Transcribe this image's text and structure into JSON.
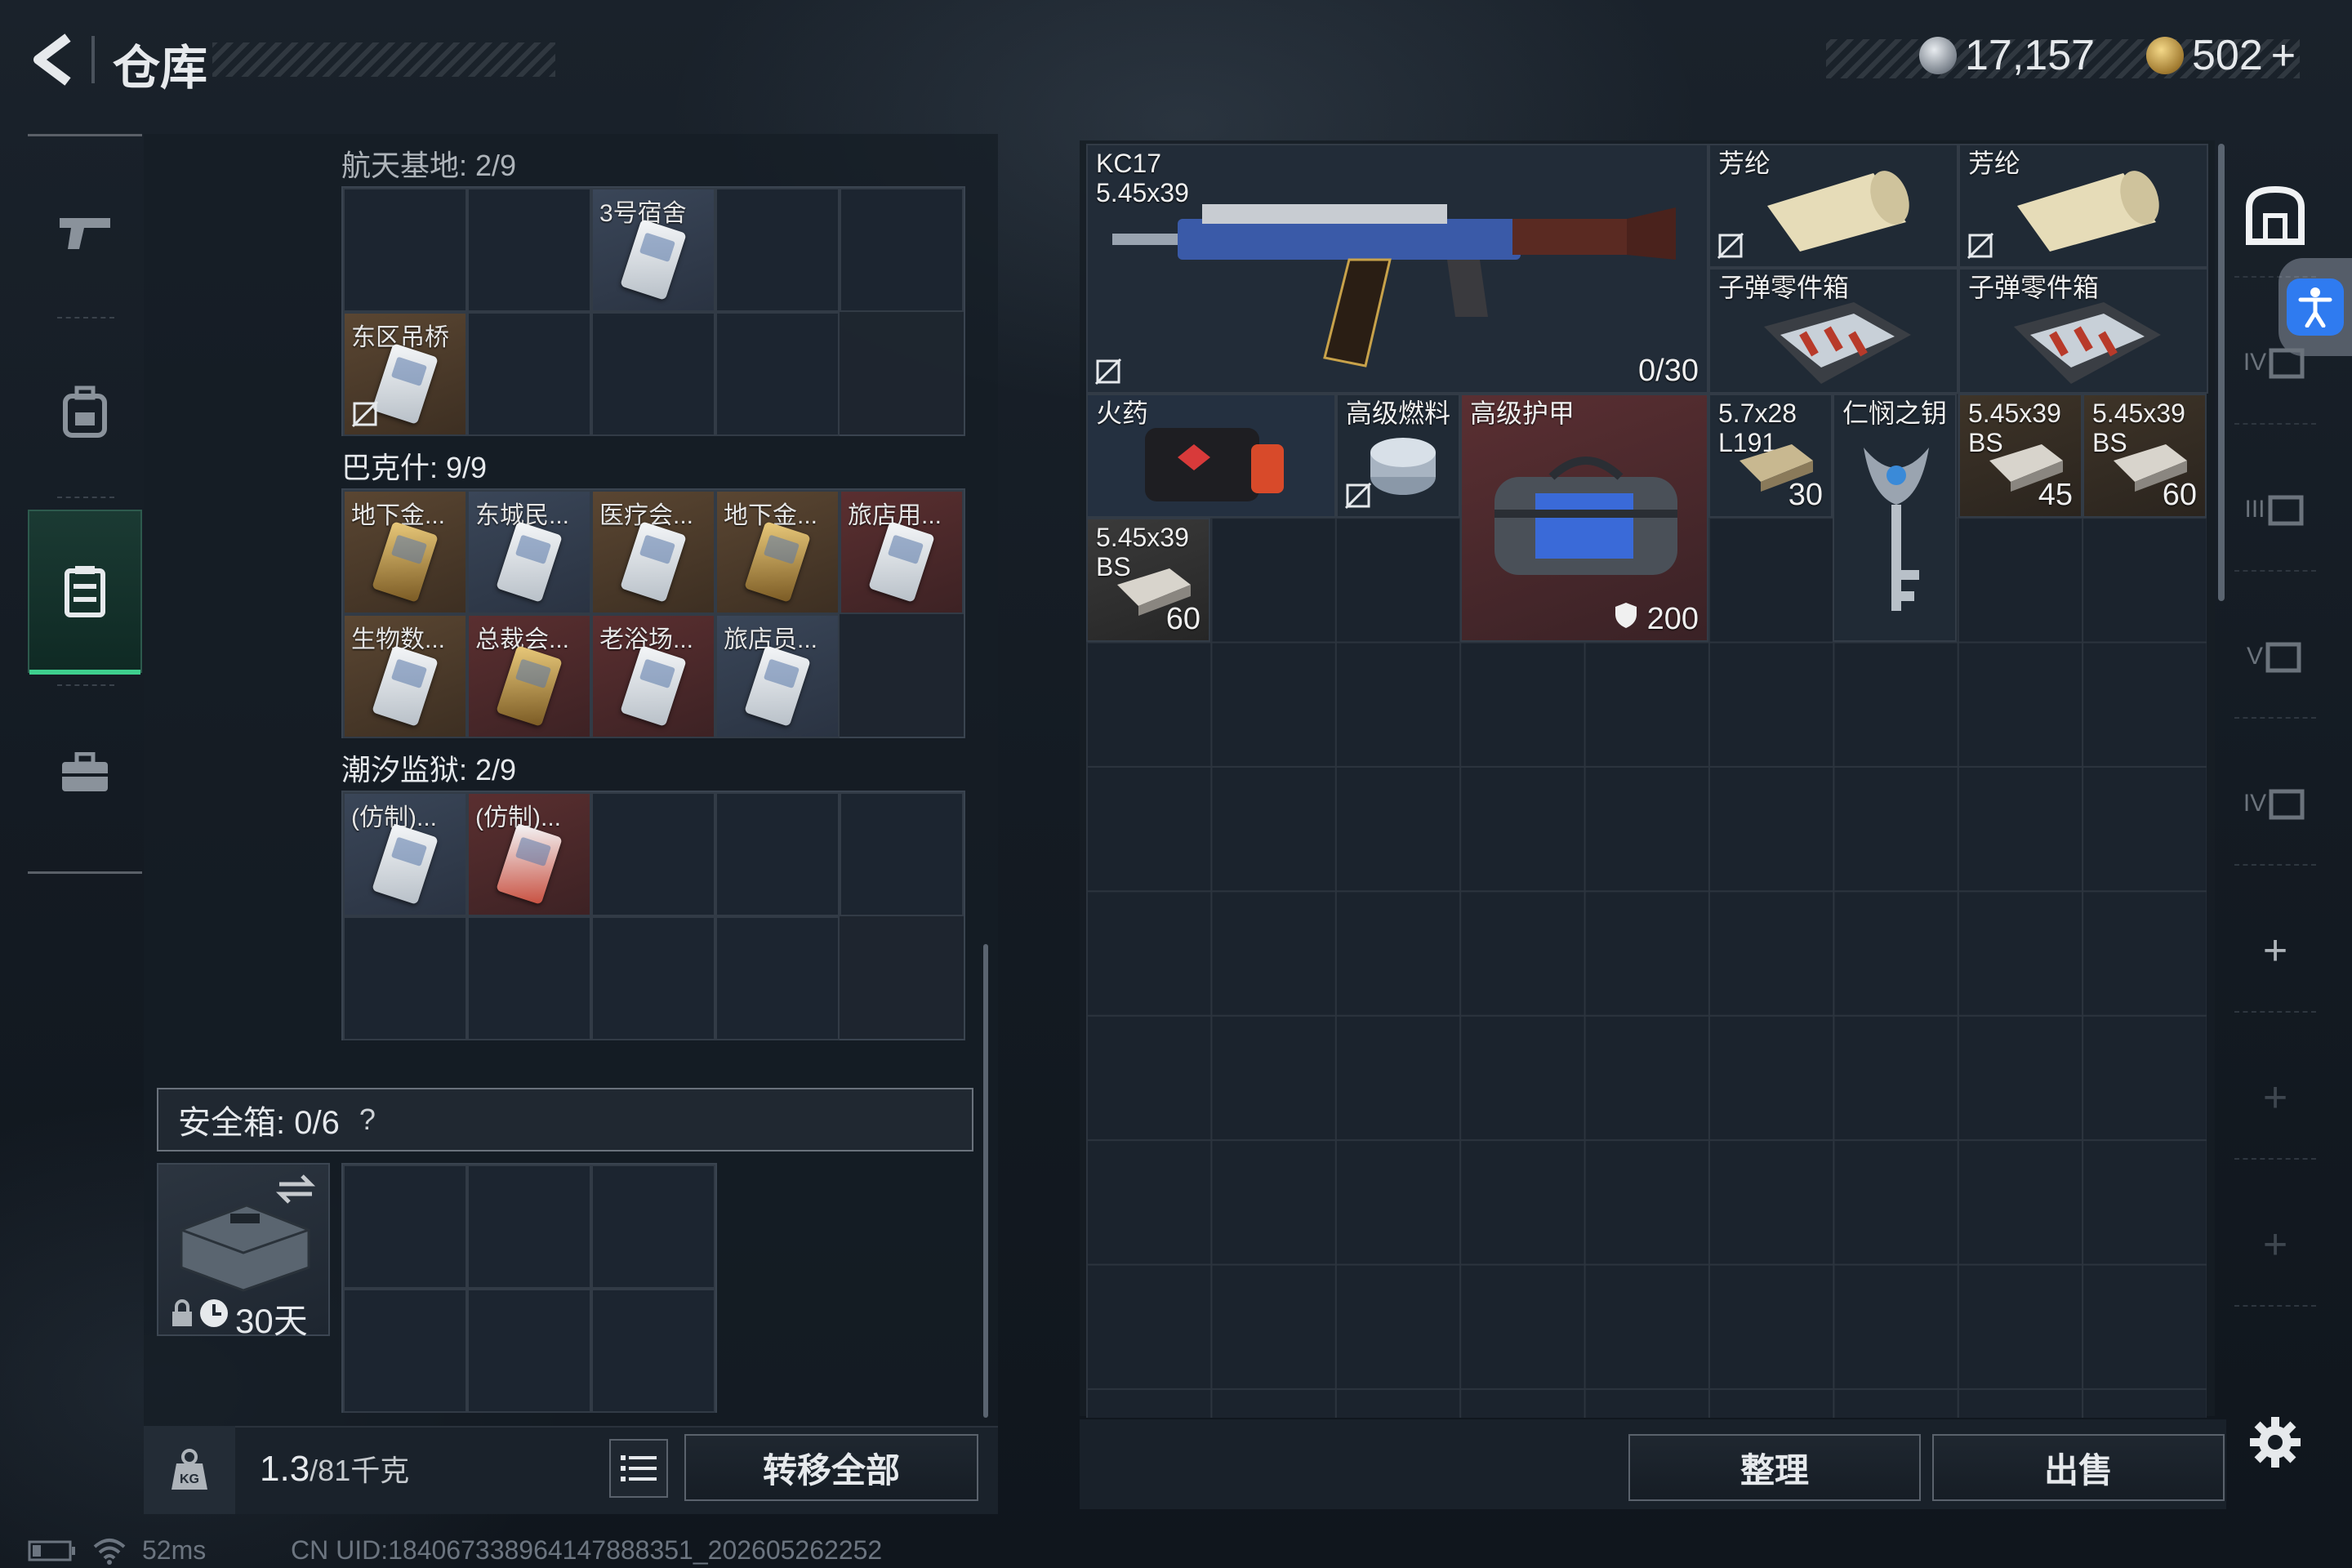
{
  "header": {
    "title": "仓库",
    "currency_silver": "17,157",
    "currency_gold": "502",
    "gold_plus": "+"
  },
  "warehouse": {
    "sections": [
      {
        "title": "航天基地: 2/9",
        "items": [
          {
            "label": "3号宿舍"
          },
          {
            "label": "东区吊桥"
          }
        ]
      },
      {
        "title": "巴克什: 9/9",
        "items": [
          {
            "label": "地下金..."
          },
          {
            "label": "东城民..."
          },
          {
            "label": "医疗会..."
          },
          {
            "label": "地下金..."
          },
          {
            "label": "旅店用..."
          },
          {
            "label": "生物数..."
          },
          {
            "label": "总裁会..."
          },
          {
            "label": "老浴场..."
          },
          {
            "label": "旅店员..."
          }
        ]
      },
      {
        "title": "潮汐监狱: 2/9",
        "items": [
          {
            "label": "(仿制)..."
          },
          {
            "label": "(仿制)..."
          }
        ]
      }
    ]
  },
  "safebox": {
    "label": "安全箱: 0/6",
    "help": "?",
    "duration": "30天"
  },
  "left_footer": {
    "weight_value": "1.3",
    "weight_max": "/81千克",
    "transfer_all": "转移全部"
  },
  "stash": {
    "items": [
      {
        "label": "KC17",
        "sub": "5.45x39",
        "count": "0/30"
      },
      {
        "label": "芳纶"
      },
      {
        "label": "芳纶"
      },
      {
        "label": "子弹零件箱"
      },
      {
        "label": "子弹零件箱"
      },
      {
        "label": "火药"
      },
      {
        "label": "高级燃料"
      },
      {
        "label": "高级护甲",
        "count": "200"
      },
      {
        "label": "5.7x28",
        "sub": "L191",
        "count": "30"
      },
      {
        "label": "仁悯之钥"
      },
      {
        "label": "5.45x39",
        "sub": "BS",
        "count": "45"
      },
      {
        "label": "5.45x39",
        "sub": "BS",
        "count": "60"
      },
      {
        "label": "5.45x39",
        "sub": "BS",
        "count": "60"
      }
    ]
  },
  "right_footer": {
    "sort": "整理",
    "sell": "出售"
  },
  "right_rail": {
    "tiers": [
      "IV",
      "III",
      "V",
      "IV"
    ],
    "add": "+"
  },
  "status": {
    "ping": "52ms",
    "uid": "CN UID:184067338964147888351_202605262252"
  },
  "colors": {
    "accent_green": "#3ecf8e",
    "accessibility_blue": "#2f7bf0",
    "rare_gold": "#5a4632",
    "rare_red": "#5a2f30"
  }
}
